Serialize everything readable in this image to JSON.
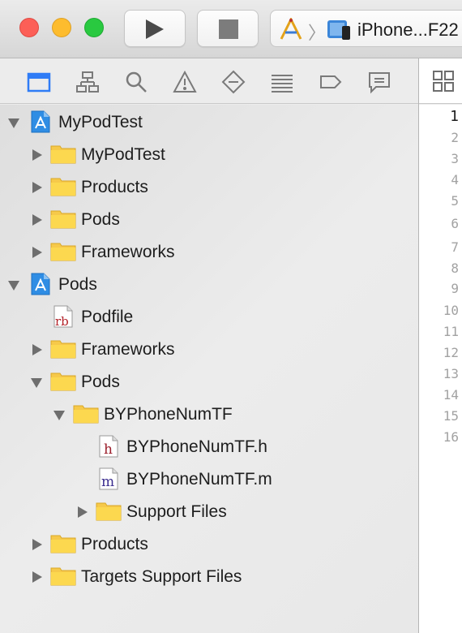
{
  "toolbar": {
    "run_icon": "play-icon",
    "stop_icon": "stop-icon",
    "scheme": {
      "device_name": "iPhone...F22"
    }
  },
  "navigator_tabs": [
    "project-navigator-icon",
    "symbol-navigator-icon",
    "find-navigator-icon",
    "issue-navigator-icon",
    "test-navigator-icon",
    "debug-navigator-icon",
    "breakpoint-navigator-icon",
    "report-navigator-icon"
  ],
  "outline": {
    "items": [
      {
        "label": "MyPodTest"
      },
      {
        "label": "MyPodTest"
      },
      {
        "label": "Products"
      },
      {
        "label": "Pods"
      },
      {
        "label": "Frameworks"
      },
      {
        "label": "Pods"
      },
      {
        "label": "Podfile",
        "badge": "rb"
      },
      {
        "label": "Frameworks"
      },
      {
        "label": "Pods"
      },
      {
        "label": "BYPhoneNumTF"
      },
      {
        "label": "BYPhoneNumTF.h",
        "badge": "h"
      },
      {
        "label": "BYPhoneNumTF.m",
        "badge": "m"
      },
      {
        "label": "Support Files"
      },
      {
        "label": "Products"
      },
      {
        "label": "Targets Support Files"
      }
    ]
  },
  "editor": {
    "line_numbers": [
      "1",
      "2",
      "3",
      "4",
      "5",
      "6",
      "7",
      "8",
      "9",
      "10",
      "11",
      "12",
      "13",
      "14",
      "15",
      "16"
    ]
  },
  "colors": {
    "close": "#fc5f57",
    "minimize": "#fdbc2e",
    "zoom": "#29c940",
    "folder": "#fcd34d",
    "accent": "#2f7cf6"
  }
}
